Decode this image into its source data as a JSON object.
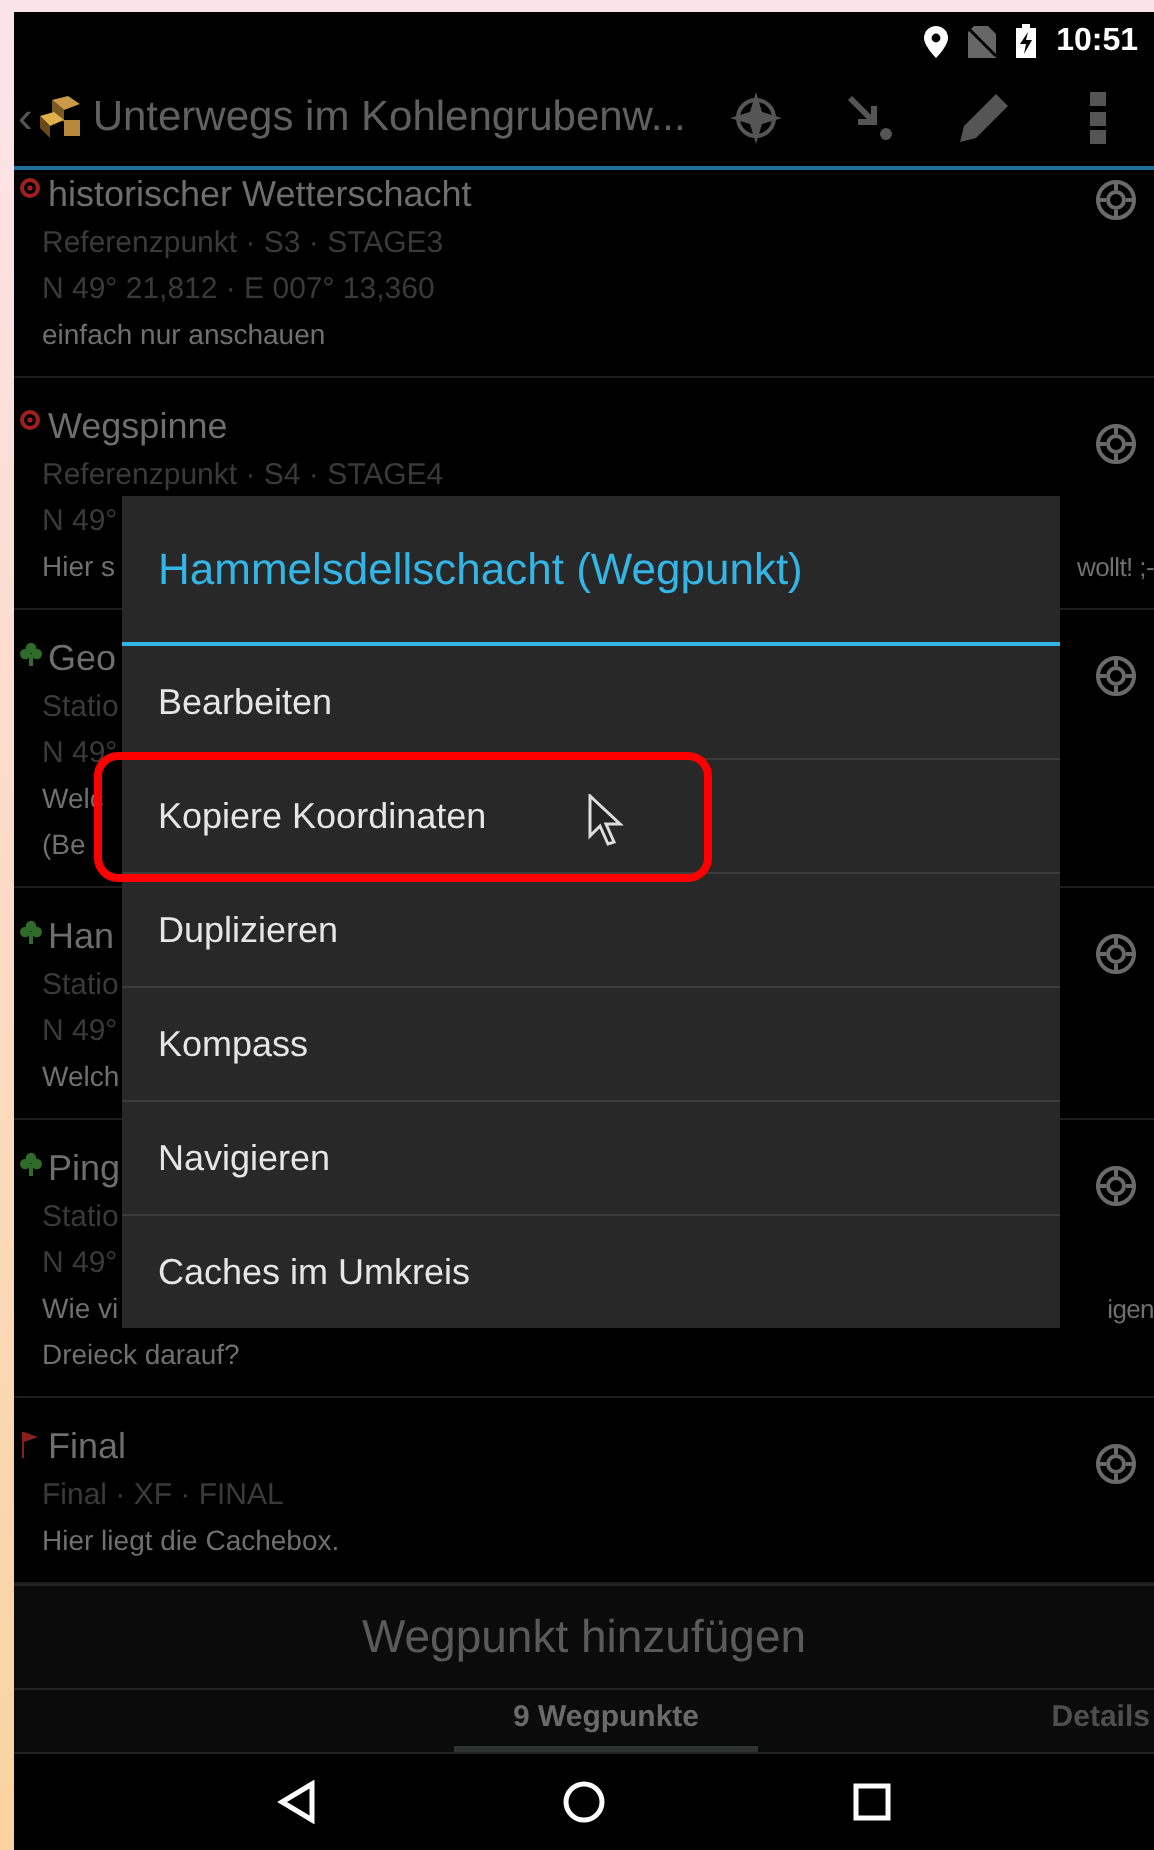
{
  "status_bar": {
    "time": "10:51"
  },
  "action_bar": {
    "back": "‹",
    "title": "Unterwegs im Kohlengrubenw..."
  },
  "waypoints": [
    {
      "kind": "reference",
      "lines": [
        {
          "kind": "title",
          "text": "historischer Wetterschacht"
        },
        {
          "kind": "meta",
          "text": "Referenzpunkt · S3 · STAGE3"
        },
        {
          "kind": "coords",
          "text": "N 49° 21,812 · E 007° 13,360"
        },
        {
          "kind": "desc",
          "text": "einfach nur anschauen"
        }
      ]
    },
    {
      "kind": "reference",
      "lines": [
        {
          "kind": "title",
          "text": "Wegspinne"
        },
        {
          "kind": "meta",
          "text": "Referenzpunkt · S4 · STAGE4"
        },
        {
          "kind": "coords",
          "text": "N 49°"
        },
        {
          "kind": "desc",
          "text": "Hier s",
          "tail": "wollt! ;-"
        }
      ]
    },
    {
      "kind": "station",
      "lines": [
        {
          "kind": "title",
          "text": "Geo"
        },
        {
          "kind": "meta",
          "text": "Statio"
        },
        {
          "kind": "coords",
          "text": "N 49°"
        },
        {
          "kind": "desc",
          "text": "Welc"
        },
        {
          "kind": "desc",
          "text": "(Be"
        }
      ]
    },
    {
      "kind": "station",
      "lines": [
        {
          "kind": "title",
          "text": "Han"
        },
        {
          "kind": "meta",
          "text": "Statio"
        },
        {
          "kind": "coords",
          "text": "N 49°"
        },
        {
          "kind": "desc",
          "text": "Welch"
        }
      ]
    },
    {
      "kind": "station",
      "lines": [
        {
          "kind": "title",
          "text": "Ping"
        },
        {
          "kind": "meta",
          "text": "Statio"
        },
        {
          "kind": "coords",
          "text": "N 49°"
        },
        {
          "kind": "desc",
          "text": "Wie vi",
          "tail": "igen"
        },
        {
          "kind": "desc",
          "text": "Dreieck darauf?"
        }
      ]
    },
    {
      "kind": "final",
      "lines": [
        {
          "kind": "title",
          "text": "Final"
        },
        {
          "kind": "meta",
          "text": "Final · XF · FINAL"
        },
        {
          "kind": "desc",
          "text": "Hier liegt die Cachebox."
        }
      ]
    }
  ],
  "add_button": "Wegpunkt hinzufügen",
  "tabs": [
    {
      "label": "9 Wegpunkte",
      "selected": true
    },
    {
      "label": "Details",
      "selected": false
    }
  ],
  "dialog": {
    "title": "Hammelsdellschacht (Wegpunkt)",
    "items": [
      {
        "label": "Bearbeiten",
        "highlighted": false
      },
      {
        "label": "Kopiere Koordinaten",
        "highlighted": true
      },
      {
        "label": "Duplizieren",
        "highlighted": false
      },
      {
        "label": "Kompass",
        "highlighted": false
      },
      {
        "label": "Navigieren",
        "highlighted": false
      },
      {
        "label": "Caches im Umkreis",
        "highlighted": false
      }
    ]
  }
}
